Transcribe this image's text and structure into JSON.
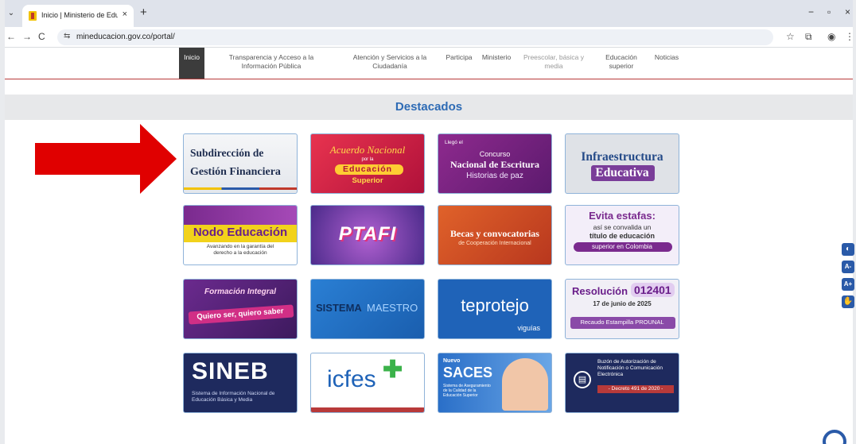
{
  "browser": {
    "tab_title": "Inicio | Ministerio de Educación",
    "tab_close": "×",
    "new_tab": "+",
    "url": "mineducacion.gov.co/portal/",
    "back": "←",
    "forward": "→",
    "reload": "C",
    "site_info": "⇆",
    "star": "☆",
    "extensions": "⧉",
    "profile": "◉",
    "menu": "⋮",
    "minimize": "−",
    "restore": "▫",
    "close": "×",
    "tab_menu": "⌄"
  },
  "nav": {
    "items": [
      {
        "label": "Inicio"
      },
      {
        "label": "Transparencia y Acceso a la Información Pública"
      },
      {
        "label": "Atención y Servicios a la Ciudadanía"
      },
      {
        "label": "Participa"
      },
      {
        "label": "Ministerio"
      },
      {
        "label": "Preescolar, básica y media"
      },
      {
        "label": "Educación superior"
      },
      {
        "label": "Noticias"
      }
    ]
  },
  "section": {
    "title": "Destacados"
  },
  "tiles": {
    "t1": {
      "line1": "Subdirección de",
      "line2": "Gestión Financiera"
    },
    "t2": {
      "line1": "Acuerdo Nacional",
      "line2": "por la",
      "line3": "Educación",
      "line4": "Superior"
    },
    "t3": {
      "line1": "Llegó el",
      "line2": "Concurso",
      "line3": "Nacional de Escritura",
      "line4": "Historias de paz"
    },
    "t4": {
      "line1": "Infraestructura",
      "line2": "Educativa"
    },
    "t5": {
      "line1": "Nodo Educación",
      "line2": "Avanzando en la garantía del derecho a la educación"
    },
    "t6": {
      "line1": "PTAFI"
    },
    "t7": {
      "line1": "Becas y convocatorias",
      "line2": "de Cooperación Internacional"
    },
    "t8": {
      "line1": "Evita estafas:",
      "line2": "así se convalida un",
      "line3": "título de educación",
      "line4": "superior en Colombia"
    },
    "t9": {
      "line1": "Formación Integral",
      "line2": "Quiero ser, quiero saber"
    },
    "t10": {
      "line1": "SISTEMA",
      "line2": "MAESTRO"
    },
    "t11": {
      "line1": "teprotejo",
      "line2": "viguías"
    },
    "t12": {
      "line1": "Resolución",
      "line2": "012401",
      "line3": "17 de junio de 2025",
      "line4": "Recaudo Estampilla PROUNAL"
    },
    "t13": {
      "line1": "SINEB",
      "line2": "Sistema de Información Nacional de Educación Básica y Media"
    },
    "t14": {
      "line1": "icfes"
    },
    "t15": {
      "line1": "Nuevo",
      "line2": "SACES",
      "line3": "Sistema de Aseguramiento de la Calidad de la Educación Superior"
    },
    "t16": {
      "line1": "Buzón de Autorización de Notificación o Comunicación Electrónica",
      "line2": "- Decreto 491 de 2020 -"
    }
  },
  "accessibility": {
    "contrast": "◐",
    "font_down": "A-",
    "font_up": "A+",
    "sign": "✋"
  },
  "colors": {
    "nav_active": "#3c3c3c",
    "accent_red": "#b83a3a",
    "title_blue": "#2e6bb5",
    "arrow_red": "#e00000"
  }
}
